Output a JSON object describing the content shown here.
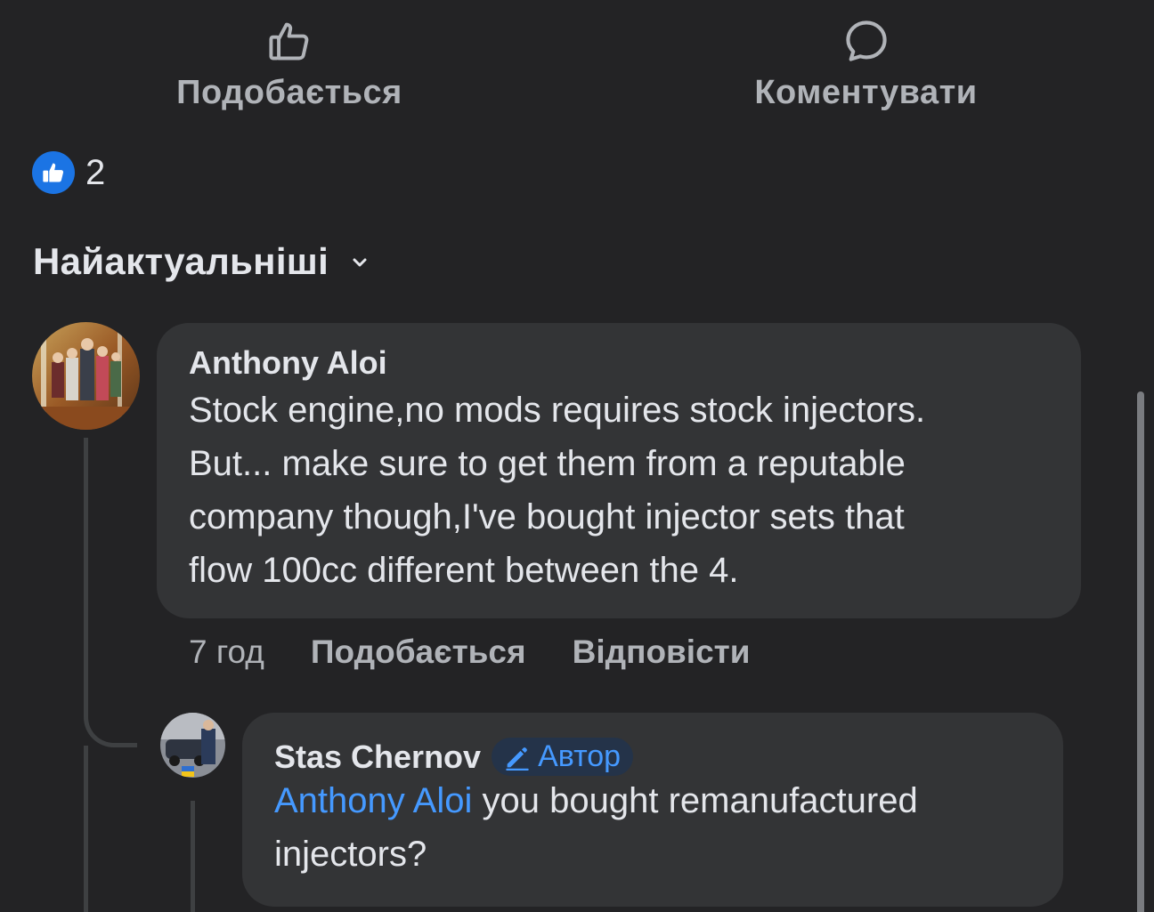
{
  "actions": {
    "like_label": "Подобається",
    "comment_label": "Коментувати",
    "like_icon": "thumbs-up-outline-icon",
    "comment_icon": "speech-bubble-icon"
  },
  "reactions": {
    "count": "2",
    "icon": "like-reaction-icon",
    "color": "#1b74e4"
  },
  "sort": {
    "label": "Найактуальніші",
    "icon": "chevron-down-icon"
  },
  "comments": [
    {
      "author": "Anthony Aloi",
      "text_lines": [
        "Stock engine,no mods requires stock injectors.",
        "But... make sure to get them from a reputable",
        "company though,I've bought injector sets that",
        "flow 100cc different between the 4."
      ],
      "time": "7 год",
      "like_label": "Подобається",
      "reply_label": "Відповісти"
    },
    {
      "author": "Stas Chernov",
      "badge": "Автор",
      "badge_icon": "pencil-icon",
      "mention": "Anthony Aloi",
      "text_line1": " you bought remanufactured",
      "text_line2": "injectors?"
    }
  ],
  "colors": {
    "background": "#232325",
    "bubble": "#333436",
    "accent": "#4599ff"
  }
}
